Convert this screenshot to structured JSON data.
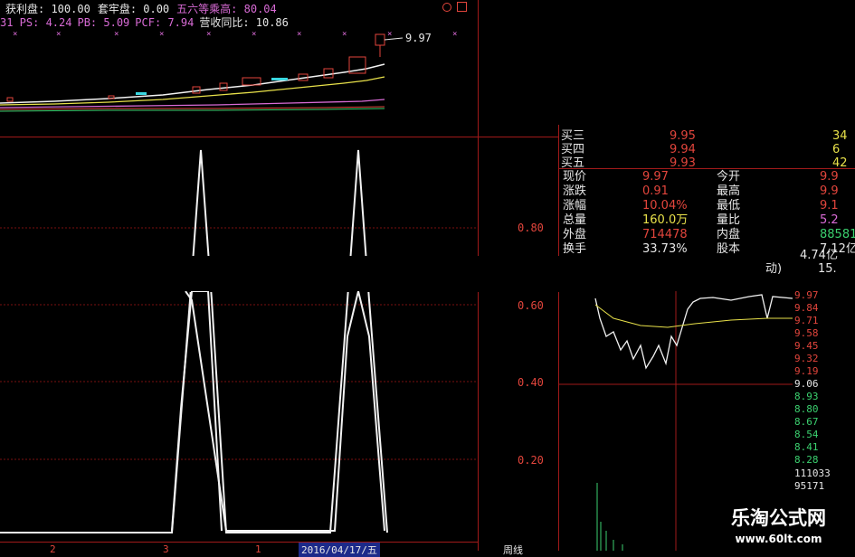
{
  "header": {
    "line1": [
      {
        "label": "获利盘: 100.00",
        "color": "#e6e6e6"
      },
      {
        "label": "套牢盘: 0.00",
        "color": "#e6e6e6"
      },
      {
        "label": "五六等乘高: 80.04",
        "color": "#d96bd6"
      }
    ],
    "line2": [
      {
        "label": "31 PS: 4.24",
        "color": "#d96bd6"
      },
      {
        "label": "PB: 5.09",
        "color": "#d96bd6"
      },
      {
        "label": "PCF: 7.94",
        "color": "#d96bd6"
      },
      {
        "label": "营收同比: 10.86",
        "color": "#e6e6e6"
      }
    ],
    "icons": [
      "circle-icon",
      "square-icon"
    ]
  },
  "kline": {
    "last_price_label": "9.97"
  },
  "indicator": {
    "y_ticks": [
      "0.80",
      "0.60",
      "0.40",
      "0.20"
    ]
  },
  "quote": {
    "bids": [
      {
        "name": "买三",
        "price": "9.95",
        "vol": "34"
      },
      {
        "name": "买四",
        "price": "9.94",
        "vol": "6"
      },
      {
        "name": "买五",
        "price": "9.93",
        "vol": "42"
      }
    ],
    "stats": [
      {
        "l1": "现价",
        "v1": "9.97",
        "c1": "#e2453c",
        "l2": "今开",
        "v2": "9.9",
        "c2": "#e2453c"
      },
      {
        "l1": "涨跌",
        "v1": "0.91",
        "c1": "#e2453c",
        "l2": "最高",
        "v2": "9.9",
        "c2": "#e2453c"
      },
      {
        "l1": "涨幅",
        "v1": "10.04%",
        "c1": "#e2453c",
        "l2": "最低",
        "v2": "9.1",
        "c2": "#e2453c"
      },
      {
        "l1": "总量",
        "v1": "160.0万",
        "c1": "#e8e14a",
        "l2": "量比",
        "v2": "5.2",
        "c2": "#d96bd6"
      },
      {
        "l1": "外盘",
        "v1": "714478",
        "c1": "#e2453c",
        "l2": "内盘",
        "v2": "88581",
        "c2": "#3bd16f"
      },
      {
        "l1": "换手",
        "v1": "33.73%",
        "c1": "#e6e6e6",
        "l2": "股本",
        "v2": "7.12亿",
        "c2": "#e6e6e6"
      }
    ],
    "partial": [
      {
        "text": "4.74亿"
      },
      {
        "text": "动)"
      },
      {
        "text": "15."
      }
    ]
  },
  "intraday": {
    "price_ticks": [
      {
        "label": "9.97",
        "color": "#e2453c"
      },
      {
        "label": "9.84",
        "color": "#e2453c"
      },
      {
        "label": "9.71",
        "color": "#e2453c"
      },
      {
        "label": "9.58",
        "color": "#e2453c"
      },
      {
        "label": "9.45",
        "color": "#e2453c"
      },
      {
        "label": "9.32",
        "color": "#e2453c"
      },
      {
        "label": "9.19",
        "color": "#e2453c"
      },
      {
        "label": "9.06",
        "color": "#e6e6e6"
      },
      {
        "label": "8.93",
        "color": "#3bd16f"
      },
      {
        "label": "8.80",
        "color": "#3bd16f"
      },
      {
        "label": "8.67",
        "color": "#3bd16f"
      },
      {
        "label": "8.54",
        "color": "#3bd16f"
      },
      {
        "label": "8.41",
        "color": "#3bd16f"
      },
      {
        "label": "8.28",
        "color": "#3bd16f"
      }
    ],
    "volume_ticks": [
      "111033",
      "95171"
    ]
  },
  "footer": {
    "date": "2016/04/17/五",
    "nums": [
      "2",
      "3",
      "1"
    ],
    "left_partial": "周线"
  },
  "watermark": {
    "title": "乐淘公式网",
    "url": "www.60lt.com"
  }
}
